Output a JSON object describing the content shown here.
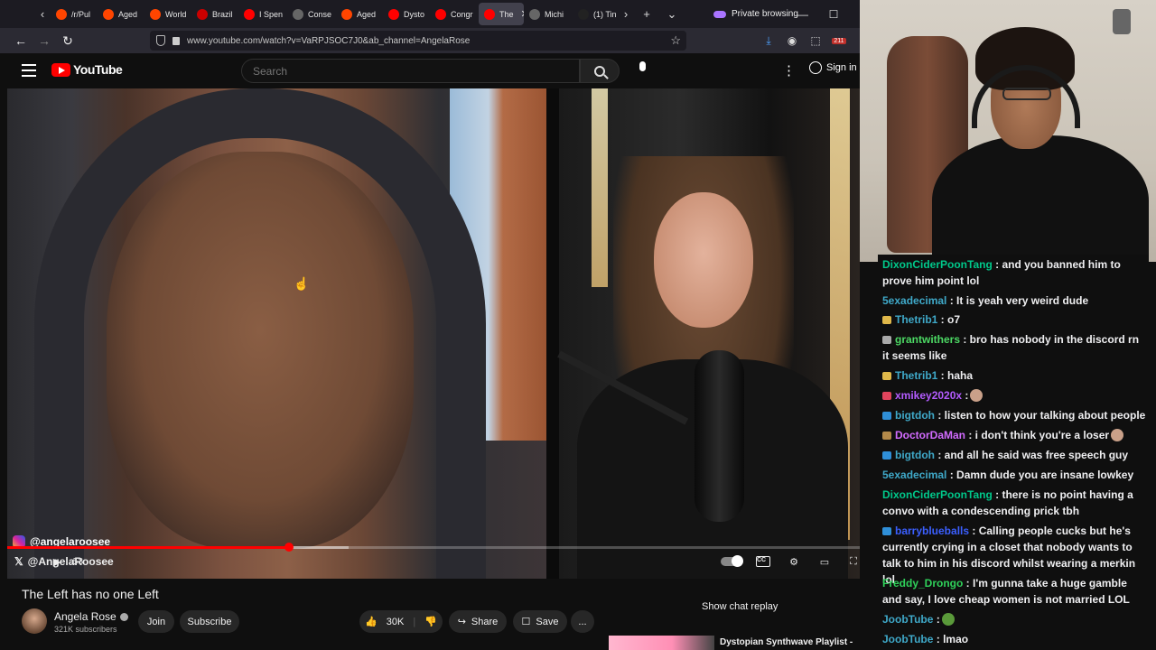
{
  "browser": {
    "tabs": [
      {
        "label": "/r/Pul",
        "color": "#ff4500"
      },
      {
        "label": "Aged",
        "color": "#ff4500"
      },
      {
        "label": "World",
        "color": "#ff4500"
      },
      {
        "label": "Brazil",
        "color": "#cc0000"
      },
      {
        "label": "I Spen",
        "color": "#ff0000"
      },
      {
        "label": "Conse",
        "color": "#666666"
      },
      {
        "label": "Aged",
        "color": "#ff4500"
      },
      {
        "label": "Dysto",
        "color": "#ff0000"
      },
      {
        "label": "Congr",
        "color": "#ff0000"
      },
      {
        "label": "The",
        "color": "#ff0000"
      },
      {
        "label": "Michi",
        "color": "#666666"
      },
      {
        "label": "(1) Tin",
        "color": "#222222"
      }
    ],
    "private_label": "Private browsing",
    "url": "www.youtube.com/watch?v=VaRPJSOC7J0&ab_channel=AngelaRose",
    "extension_badge": "211"
  },
  "youtube": {
    "logo_text": "YouTube",
    "search_placeholder": "Search",
    "signin_label": "Sign in",
    "video": {
      "instagram_handle": "@angelaroosee",
      "x_handle": "@AngelaRoosee",
      "time_text": ":53",
      "progress": 0.33,
      "buffered_end": 0.4
    },
    "title": "The Left has no one Left",
    "channel_name": "Angela Rose",
    "subscribers": "321K subscribers",
    "join_label": "Join",
    "subscribe_label": "Subscribe",
    "likes": "30K",
    "share_label": "Share",
    "save_label": "Save",
    "more_label": "...",
    "show_chat_replay": "Show chat replay",
    "recommended_title": "Dystopian Synthwave Playlist -"
  },
  "chat": {
    "messages": [
      {
        "user": "DixonCiderPoonTang",
        "text": " : and you banned him to prove him point lol",
        "color": "#00c98b",
        "badge": ""
      },
      {
        "user": "5exadecimal",
        "text": " : It is yeah very weird dude",
        "color": "#3fa9c9",
        "badge": ""
      },
      {
        "user": "Thetrib1",
        "text": " : o7",
        "color": "#3fa9c9",
        "badge": "#e0b84a"
      },
      {
        "user": "grantwithers",
        "text": " : bro has nobody in the discord rn it seems like",
        "color": "#4cd964",
        "badge": "#aaaaaa"
      },
      {
        "user": "Thetrib1",
        "text": " : haha",
        "color": "#3fa9c9",
        "badge": "#e0b84a"
      },
      {
        "user": "xmikey2020x",
        "text": " :",
        "color": "#b45cff",
        "badge": "#e0445c"
      },
      {
        "user": "bigtdoh",
        "text": " : listen to how your talking about people",
        "color": "#3fa9c9",
        "badge": "#2f8fd8"
      },
      {
        "user": "DoctorDaMan",
        "text": " : i don't think you're a loser",
        "color": "#d26bff",
        "badge": "#b48a4a"
      },
      {
        "user": "bigtdoh",
        "text": " : and all he said was free speech guy",
        "color": "#3fa9c9",
        "badge": "#2f8fd8"
      },
      {
        "user": "5exadecimal",
        "text": " : Damn dude you are insane lowkey",
        "color": "#3fa9c9",
        "badge": ""
      },
      {
        "user": "DixonCiderPoonTang",
        "text": " : there is no point having a convo with a condescending prick tbh",
        "color": "#00c98b",
        "badge": ""
      },
      {
        "user": "barryblueballs",
        "text": " : Calling people cucks but he's currently crying in a closet that nobody wants to talk to him in his discord whilst wearing a merkin lol",
        "color": "#3b5fff",
        "badge": "#2f8fd8"
      },
      {
        "user": "Freddy_Drongo",
        "text": " : I'm gunna take a huge gamble and say, I love cheap women is not married LOL",
        "color": "#2fd15a",
        "badge": ""
      },
      {
        "user": "JoobTube",
        "text": " :",
        "color": "#3fa9c9",
        "badge": ""
      },
      {
        "user": "JoobTube",
        "text": " : lmao",
        "color": "#3fa9c9",
        "badge": ""
      }
    ]
  }
}
